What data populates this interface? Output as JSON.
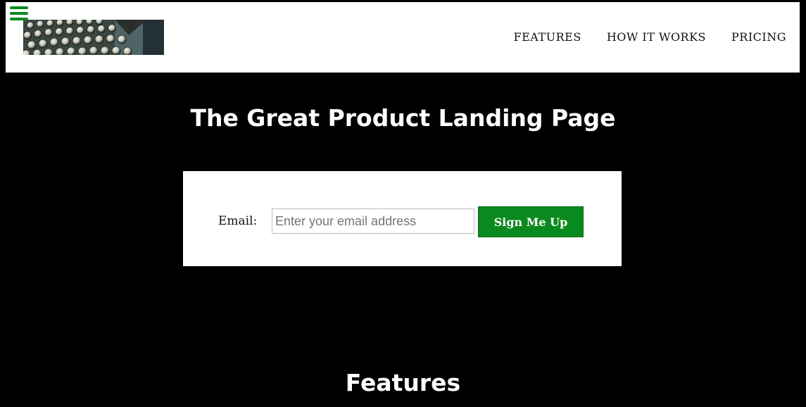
{
  "header": {
    "menu_icon": "hamburger-menu-icon",
    "logo_image": "typewriter-keys-image",
    "nav": [
      {
        "label": "FEATURES"
      },
      {
        "label": "HOW IT WORKS"
      },
      {
        "label": "PRICING"
      }
    ]
  },
  "hero": {
    "title": "The Great Product Landing Page"
  },
  "form": {
    "email_label": "Email:",
    "email_placeholder": "Enter your email address",
    "email_value": "",
    "submit_label": "Sign Me Up"
  },
  "features": {
    "title": "Features"
  },
  "colors": {
    "accent": "#0a8a1e",
    "background": "#000000",
    "header_background": "#ffffff"
  }
}
